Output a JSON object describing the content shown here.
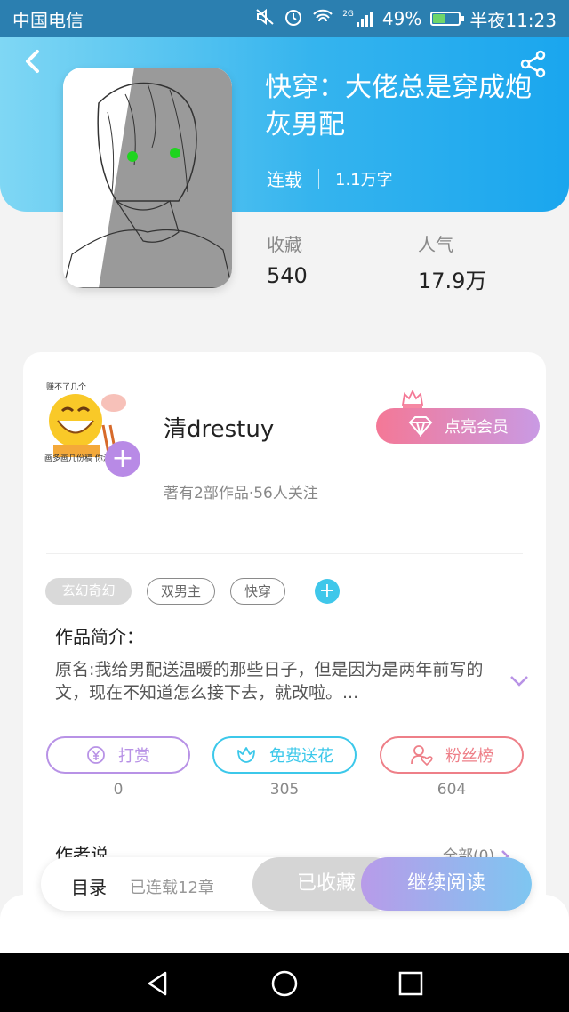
{
  "status_bar": {
    "carrier": "中国电信",
    "network": "2G",
    "battery": "49%",
    "battery_level": 0.49,
    "time_label": "半夜11:23"
  },
  "book": {
    "title": "快穿：大佬总是穿成炮灰男配",
    "status": "连载",
    "word_count": "1.1万字",
    "favorites_label": "收藏",
    "favorites": "540",
    "popularity_label": "人气",
    "popularity": "17.9万"
  },
  "author": {
    "avatar_text_top": "赚不了几个",
    "avatar_text_bottom": "画多画几份稿 你没时间",
    "name": "清drestuy",
    "info": "著有2部作品·56人关注",
    "vip_button": "点亮会员"
  },
  "tags": [
    "玄幻奇幻",
    "双男主",
    "快穿"
  ],
  "intro": {
    "heading": "作品简介：",
    "text": "原名:我给男配送温暖的那些日子，但是因为是两年前写的文，现在不知道怎么接下去，就改啦。..."
  },
  "actions": [
    {
      "label": "打赏",
      "count": "0",
      "color": "#b892e6"
    },
    {
      "label": "免费送花",
      "count": "305",
      "color": "#3cc8ea"
    },
    {
      "label": "粉丝榜",
      "count": "604",
      "color": "#ee7f88"
    }
  ],
  "author_say": {
    "heading": "作者说",
    "all_link": "全部(0)"
  },
  "bottom_bar": {
    "toc": "目录",
    "chapters": "已连载12章",
    "favorited": "已收藏",
    "continue_reading": "继续阅读"
  }
}
